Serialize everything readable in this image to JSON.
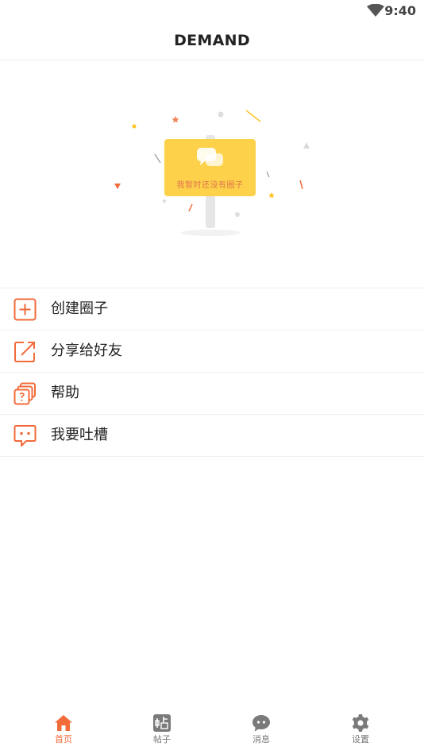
{
  "status_bar": {
    "time": "9:40"
  },
  "header": {
    "title": "DEMAND"
  },
  "empty_state": {
    "text": "我暂时还没有圈子"
  },
  "menu": {
    "items": [
      {
        "label": "创建圈子",
        "icon": "add-box-icon"
      },
      {
        "label": "分享给好友",
        "icon": "share-external-icon"
      },
      {
        "label": "帮助",
        "icon": "help-stack-icon"
      },
      {
        "label": "我要吐槽",
        "icon": "feedback-chat-icon"
      }
    ]
  },
  "tabbar": {
    "tabs": [
      {
        "label": "首页",
        "icon": "home-icon",
        "active": true
      },
      {
        "label": "帖子",
        "icon": "post-icon",
        "active": false
      },
      {
        "label": "消息",
        "icon": "message-icon",
        "active": false
      },
      {
        "label": "设置",
        "icon": "settings-gear-icon",
        "active": false
      }
    ]
  },
  "colors": {
    "accent": "#f26b3a",
    "sign": "#fdd24a",
    "divider": "#efefef"
  }
}
